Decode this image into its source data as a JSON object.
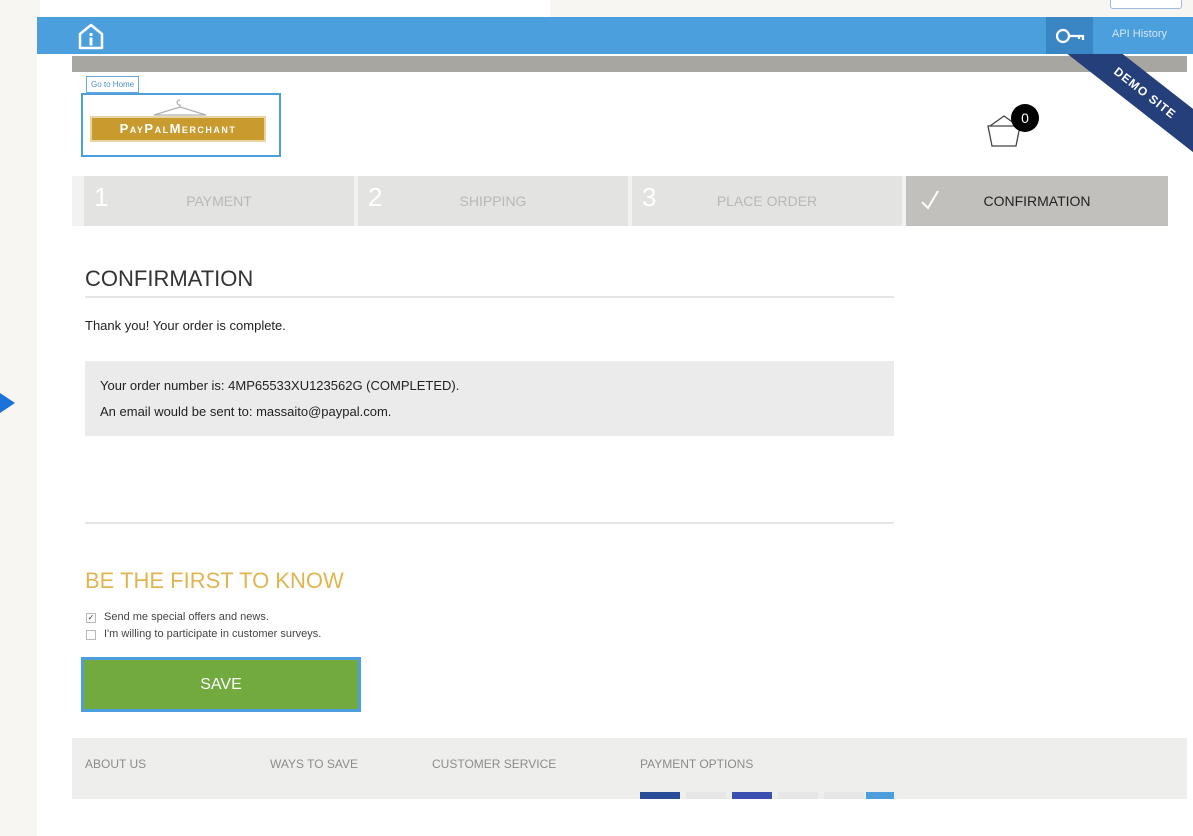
{
  "header": {
    "api_history": "API History",
    "demo_label": "DEMO SITE",
    "goto_home": "Go to Home",
    "logo_text": "PayPalMerchant",
    "cart_count": "0",
    "icons": {
      "home": "info-home-icon",
      "key": "key-icon",
      "cart": "cart-icon"
    }
  },
  "steps": [
    {
      "num": "1",
      "label": "PAYMENT"
    },
    {
      "num": "2",
      "label": "SHIPPING"
    },
    {
      "num": "3",
      "label": "PLACE ORDER"
    },
    {
      "num": "✓",
      "label": "CONFIRMATION"
    }
  ],
  "confirmation": {
    "title": "CONFIRMATION",
    "thank_you": "Thank you! Your order is complete.",
    "order_line": "Your order number is: 4MP65533XU123562G (COMPLETED).",
    "email_line": "An email would be sent to: massaito@paypal.com."
  },
  "newsletter": {
    "title": "BE THE FIRST TO KNOW",
    "options": [
      {
        "label": "Send me special offers and news.",
        "checked": true
      },
      {
        "label": "I'm willing to participate in customer surveys.",
        "checked": false
      }
    ],
    "save_label": "SAVE"
  },
  "footer": {
    "columns": [
      "ABOUT US",
      "WAYS TO SAVE",
      "CUSTOMER SERVICE",
      "PAYMENT OPTIONS"
    ]
  },
  "colors": {
    "appbar": "#4a9fdc",
    "accent_gold": "#e0b550",
    "save_green": "#72aa40",
    "ribbon": "#243f7a"
  }
}
